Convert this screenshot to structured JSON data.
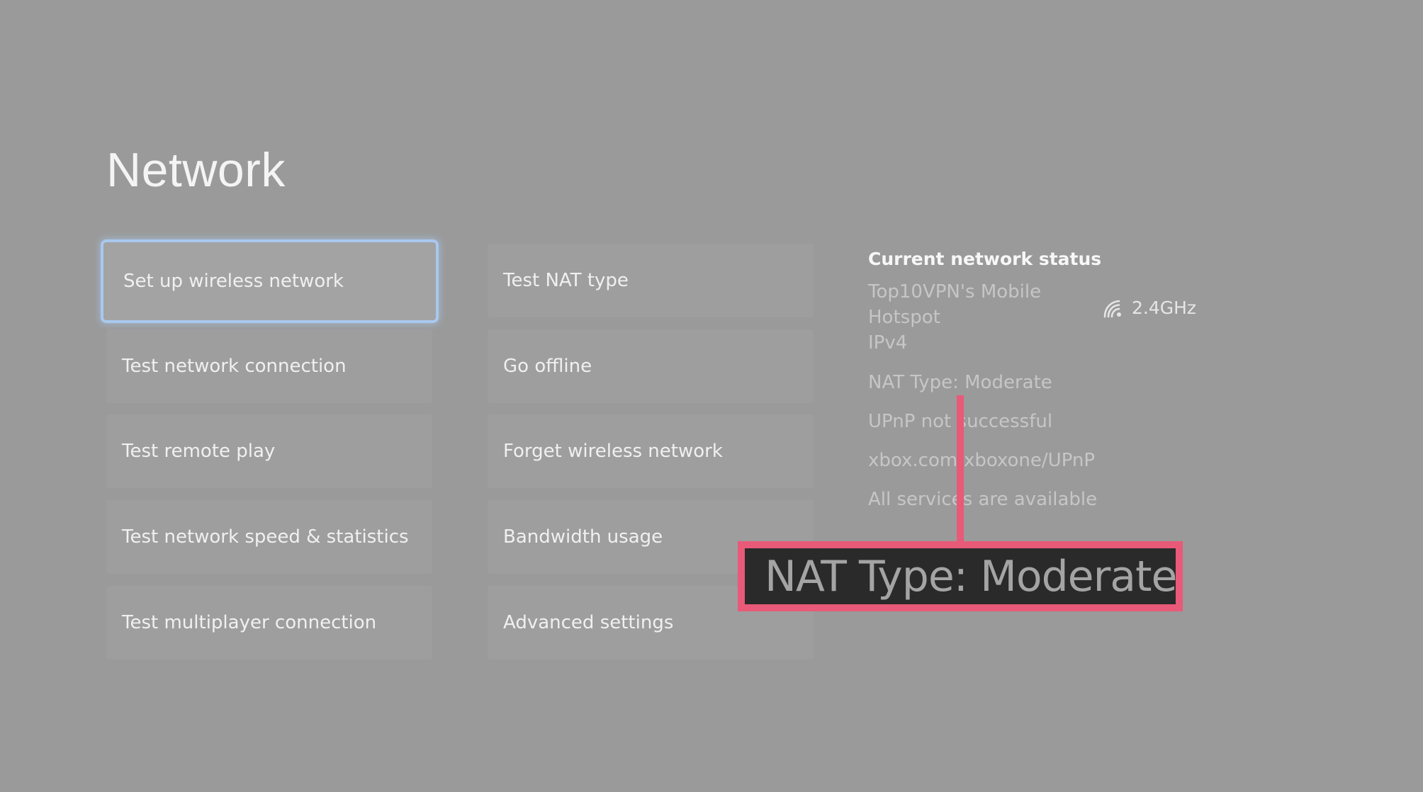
{
  "page": {
    "title": "Network"
  },
  "menu": {
    "left_column": [
      {
        "label": "Set up wireless network",
        "focused": true
      },
      {
        "label": "Test network connection"
      },
      {
        "label": "Test remote play"
      },
      {
        "label": "Test network speed & statistics"
      },
      {
        "label": "Test multiplayer connection"
      }
    ],
    "right_column": [
      {
        "label": "Test NAT type"
      },
      {
        "label": "Go offline"
      },
      {
        "label": "Forget wireless network"
      },
      {
        "label": "Bandwidth usage"
      },
      {
        "label": "Advanced settings"
      }
    ]
  },
  "status": {
    "heading": "Current network status",
    "network_name_line1": "Top10VPN's Mobile",
    "network_name_line2": "Hotspot",
    "ip_version": "IPv4",
    "band_icon": "wifi-signal-icon",
    "band": "2.4GHz",
    "lines": [
      "NAT Type: Moderate",
      "UPnP not successful",
      "xbox.com/xboxone/UPnP",
      "All services are available"
    ]
  },
  "annotation": {
    "callout_text": "NAT Type: Moderate",
    "color": "#e85a78"
  },
  "colors": {
    "background": "#9a9a9a",
    "focus_border": "#a8c8ee"
  }
}
